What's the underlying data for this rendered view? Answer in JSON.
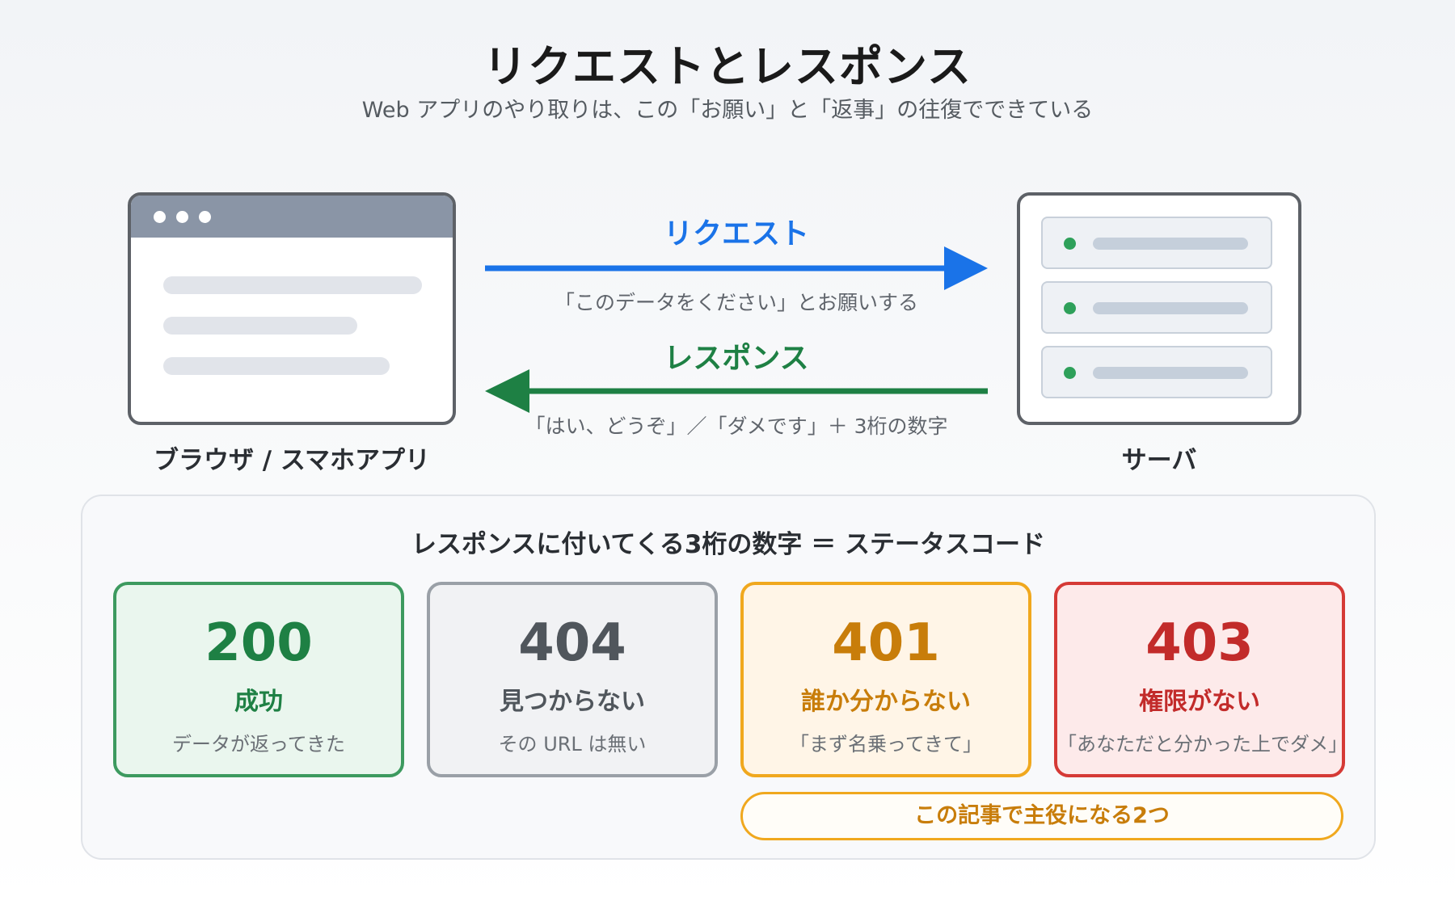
{
  "header": {
    "title": "リクエストとレスポンス",
    "subtitle": "Web アプリのやり取りは、この「お願い」と「返事」の往復でできている"
  },
  "client": {
    "label": "ブラウザ / スマホアプリ"
  },
  "server": {
    "label": "サーバ"
  },
  "request": {
    "label": "リクエスト",
    "caption": "「このデータをください」とお願いする",
    "color": "#1a73e8"
  },
  "response": {
    "label": "レスポンス",
    "caption": "「はい、どうぞ」／「ダメです」＋ 3桁の数字",
    "color": "#1e8044"
  },
  "status_panel": {
    "title": "レスポンスに付いてくる3桁の数字 ＝ ステータスコード",
    "cards": [
      {
        "code": "200",
        "meaning": "成功",
        "detail": "データが返ってきた",
        "color": "#1e8044"
      },
      {
        "code": "404",
        "meaning": "見つからない",
        "detail": "その URL は無い",
        "color": "#50565c"
      },
      {
        "code": "401",
        "meaning": "誰か分からない",
        "detail": "「まず名乗ってきて」",
        "color": "#c87d0a"
      },
      {
        "code": "403",
        "meaning": "権限がない",
        "detail": "「あなただと分かった上でダメ」",
        "color": "#c22b2a"
      }
    ],
    "highlight": "この記事で主役になる2つ"
  }
}
